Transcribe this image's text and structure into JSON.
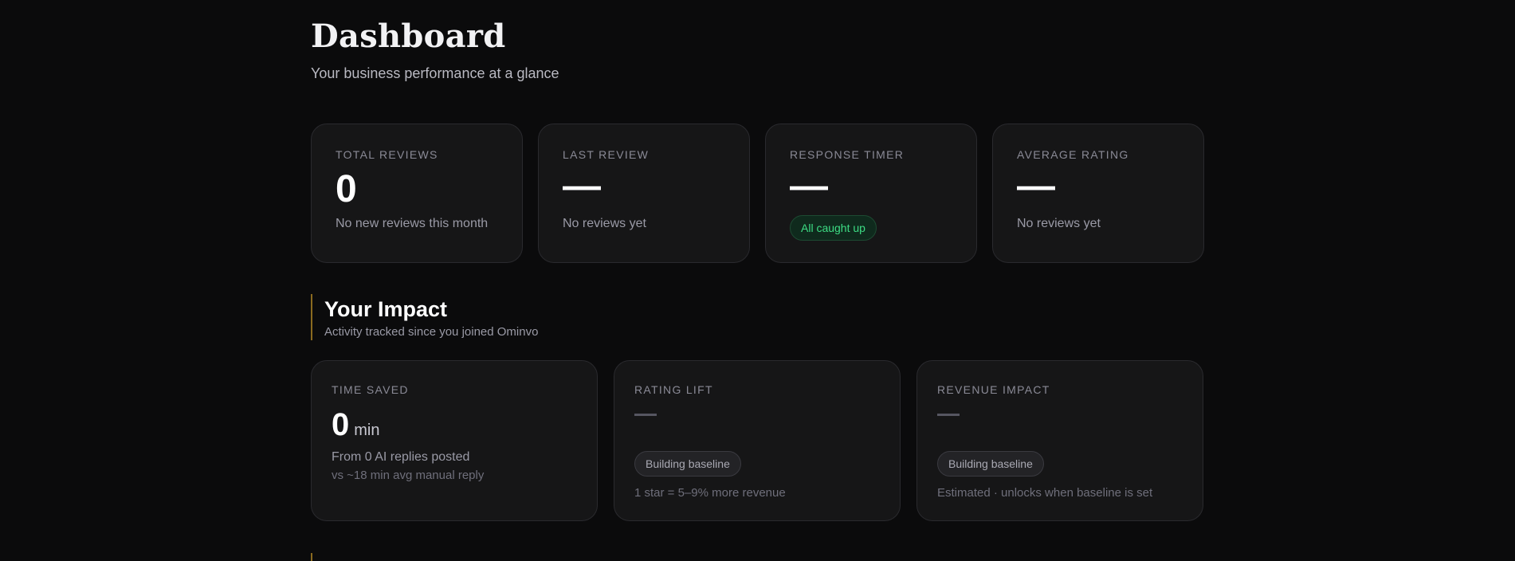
{
  "header": {
    "title": "Dashboard",
    "subtitle": "Your business performance at a glance"
  },
  "stats": [
    {
      "label": "TOTAL REVIEWS",
      "value": "0",
      "note": "No new reviews this month"
    },
    {
      "label": "LAST REVIEW",
      "value": "—",
      "note": "No reviews yet"
    },
    {
      "label": "RESPONSE TIMER",
      "value": "—",
      "badge": "All caught up"
    },
    {
      "label": "AVERAGE RATING",
      "value": "—",
      "note": "No reviews yet"
    }
  ],
  "impact": {
    "title": "Your Impact",
    "subtitle": "Activity tracked since you joined Ominvo",
    "cards": [
      {
        "label": "TIME SAVED",
        "value": "0",
        "unit": "min",
        "note": "From 0 AI replies posted",
        "subnote": "vs ~18 min avg manual reply"
      },
      {
        "label": "RATING LIFT",
        "badge": "Building baseline",
        "note": "1 star = 5–9% more revenue"
      },
      {
        "label": "REVENUE IMPACT",
        "badge": "Building baseline",
        "note": "Estimated · unlocks when baseline is set"
      }
    ]
  },
  "colors": {
    "background": "#0b0b0c",
    "card": "#161617",
    "accent_success": "#3ddc84",
    "section_bar": "#8a6a1f"
  }
}
